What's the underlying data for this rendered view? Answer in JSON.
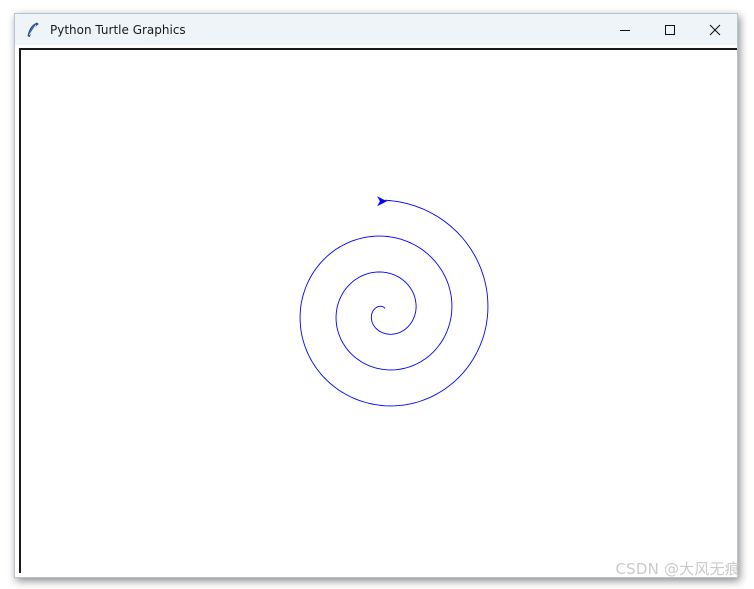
{
  "window": {
    "title": "Python Turtle Graphics",
    "icon": "feather-icon",
    "controls": [
      "minimize-icon",
      "maximize-icon",
      "close-icon"
    ]
  },
  "canvas": {
    "background": "#ffffff",
    "drawing": "spiral",
    "pen_color": "#0000ff",
    "turtle_shape": "arrow",
    "turtle_heading": "right"
  },
  "watermark": "CSDN @大风无痕"
}
